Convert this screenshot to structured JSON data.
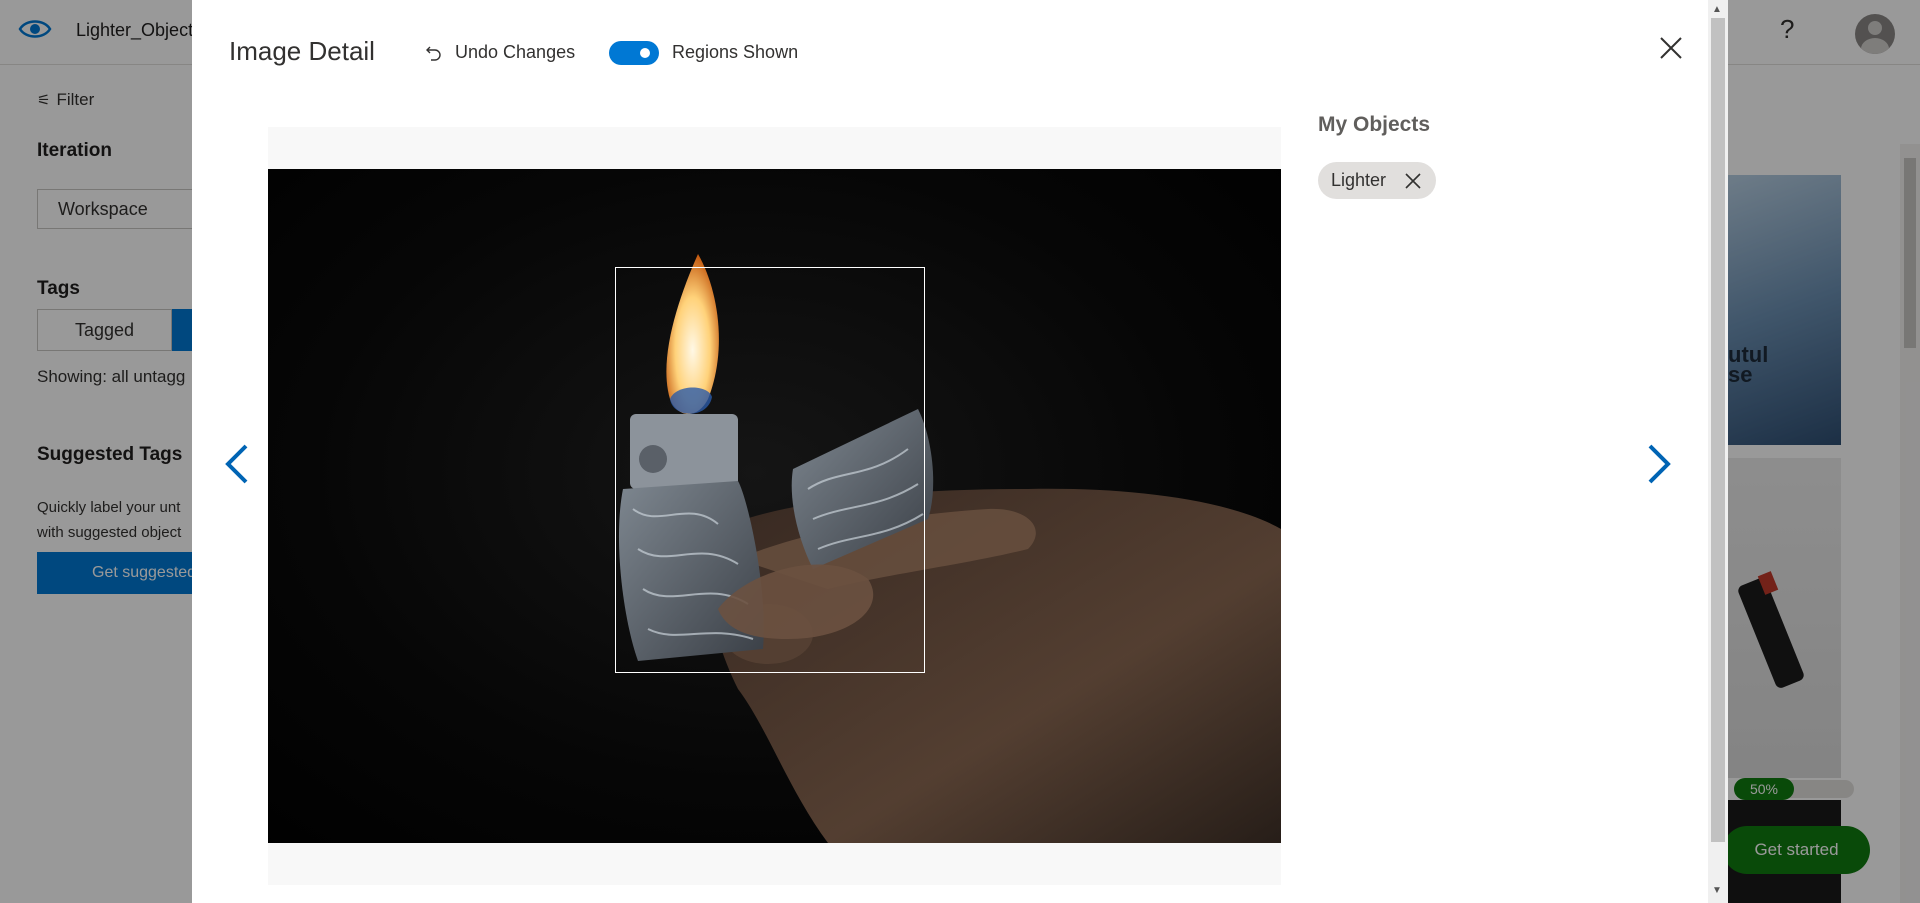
{
  "app": {
    "title": "Lighter_Object",
    "help_glyph": "?",
    "filter_label": "Filter",
    "iteration_title": "Iteration",
    "iteration_value": "Workspace",
    "tags_title": "Tags",
    "tagged_label": "Tagged",
    "showing_text": "Showing: all untagg",
    "suggested_title": "Suggested Tags",
    "suggested_desc": "Quickly label your unt with suggested object",
    "suggest_button": "Get suggested",
    "thumb_text": "utul\nse",
    "progress_label": "50%",
    "progress": 0.5,
    "get_started": "Get started"
  },
  "modal": {
    "title": "Image Detail",
    "undo_label": "Undo Changes",
    "regions_toggle_label": "Regions Shown",
    "regions_toggle_on": true,
    "objects_title": "My Objects",
    "objects": [
      {
        "label": "Lighter"
      }
    ]
  },
  "icons": {
    "logo": "eye-icon",
    "undo": "undo-icon",
    "close": "close-icon",
    "prev": "chevron-left-icon",
    "next": "chevron-right-icon",
    "remove": "close-icon",
    "filter": "sliders-icon",
    "avatar": "user-icon"
  },
  "colors": {
    "accent": "#0078d4",
    "success": "#107c10",
    "chip_bg": "#e1dfdd"
  }
}
